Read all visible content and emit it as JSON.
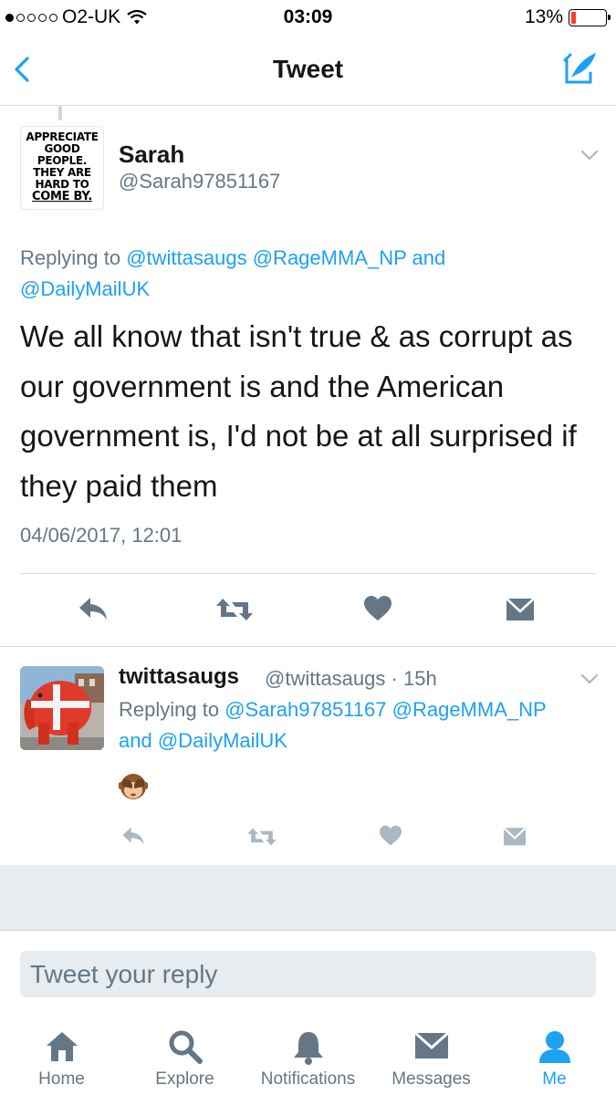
{
  "status_bar": {
    "carrier": "O2-UK",
    "time": "03:09",
    "battery_percent": "13%",
    "battery_level": 0.13,
    "signal_bars": 1,
    "battery_color": "#ff3b30"
  },
  "nav": {
    "title": "Tweet",
    "back_icon": "chevron-left-icon",
    "compose_icon": "compose-tweet-icon",
    "accent_color": "#1da1f2"
  },
  "main_tweet": {
    "avatar_text": {
      "line1": "APPRECIATE",
      "line2": "GOOD",
      "line3": "PEOPLE.",
      "line4": "THEY ARE",
      "line5": "HARD TO",
      "line6": "COME BY."
    },
    "name": "Sarah",
    "handle": "@Sarah97851167",
    "replying_prefix": "Replying to",
    "replying_mention1": "@twittasaugs",
    "replying_mention2": "@RageMMA_NP",
    "replying_and": "and",
    "replying_mention3": "@DailyMailUK",
    "text": "We all know that isn't true & as corrupt as our government is and the American government is, I'd not be at all surprised if they paid them",
    "timestamp": "04/06/2017, 12:01"
  },
  "reply_tweet": {
    "name": "twittasaugs",
    "handle": "@twittasaugs",
    "separator": "·",
    "age": "15h",
    "replying_prefix": "Replying to",
    "replying_mention1": "@Sarah97851167",
    "replying_mention2": "@RageMMA_NP",
    "replying_and": "and",
    "replying_mention3": "@DailyMailUK",
    "emoji_icon": "see-no-evil-monkey-icon"
  },
  "reply_box": {
    "placeholder": "Tweet your reply"
  },
  "tabbar": {
    "items": [
      {
        "label": "Home",
        "icon": "home-icon"
      },
      {
        "label": "Explore",
        "icon": "search-icon"
      },
      {
        "label": "Notifications",
        "icon": "bell-icon"
      },
      {
        "label": "Messages",
        "icon": "envelope-icon"
      },
      {
        "label": "Me",
        "icon": "person-icon"
      }
    ],
    "active_index": 4
  }
}
